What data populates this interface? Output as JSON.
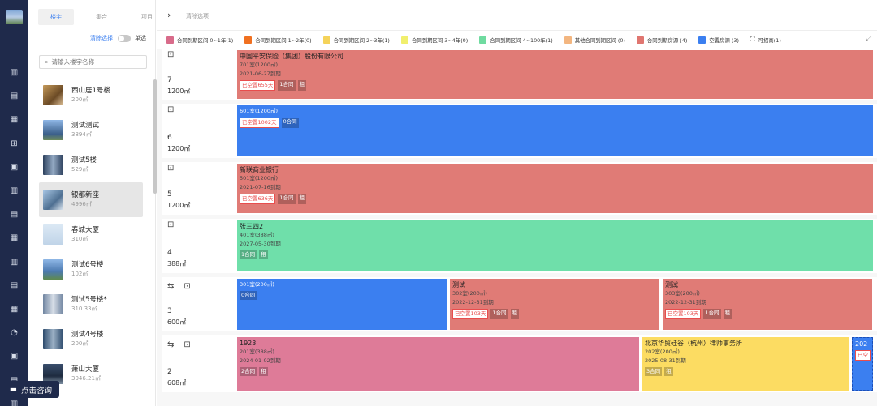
{
  "rail": {
    "icons": [
      "book-icon",
      "document-icon",
      "ledger-icon",
      "car-icon",
      "gear-icon",
      "list-icon",
      "ticket-icon",
      "wallet-icon",
      "grid-icon",
      "chart-icon",
      "calendar-icon",
      "refresh-icon",
      "money-icon",
      "report-icon",
      "folder-icon"
    ]
  },
  "consult": {
    "label": "点击咨询"
  },
  "panel": {
    "tabs": [
      "楼宇",
      "集合",
      "项目"
    ],
    "clear": "清除选择",
    "single": "单选",
    "search_placeholder": "请输入楼宇名称",
    "buildings": [
      {
        "name": "西山居1号楼",
        "area": "200㎡"
      },
      {
        "name": "测试测试",
        "area": "3894㎡"
      },
      {
        "name": "测试5楼",
        "area": "529㎡"
      },
      {
        "name": "银都新座",
        "area": "4996㎡"
      },
      {
        "name": "春城大厦",
        "area": "310㎡"
      },
      {
        "name": "测试6号楼",
        "area": "102㎡"
      },
      {
        "name": "测试5号楼*",
        "area": "310.33㎡"
      },
      {
        "name": "测试4号楼",
        "area": "200㎡"
      },
      {
        "name": "萧山大厦",
        "area": "3046.21㎡"
      }
    ]
  },
  "topbar": {
    "filter_title": "清除选项"
  },
  "legend": [
    {
      "label": "合同到期区间 0~1年(1)",
      "color": "#d86b8a"
    },
    {
      "label": "合同到期区间 1~2年(0)",
      "color": "#f07020"
    },
    {
      "label": "合同到期区间 2~3年(1)",
      "color": "#f5d35a"
    },
    {
      "label": "合同到期区间 3~4年(0)",
      "color": "#f1ef6d"
    },
    {
      "label": "合同到期区间 4~100年(1)",
      "color": "#6fdba0"
    },
    {
      "label": "其他合同到期区间 (0)",
      "color": "#f3b680"
    },
    {
      "label": "合同到期房源 (4)",
      "color": "#e07670"
    },
    {
      "label": "空置房源 (3)",
      "color": "#3b7ff0"
    },
    {
      "label": "可招商(1)",
      "color": ""
    }
  ],
  "colors": {
    "red": "#e07b76",
    "blue": "#3b7ff0",
    "green": "#6fdfaa",
    "pink": "#de7b98",
    "yellow": "#fcdc62"
  },
  "floors": [
    {
      "num": "7",
      "area": "1200㎡",
      "units": [
        {
          "name": "中国平安保险（集团）股份有限公司",
          "room": "701室(1200㎡)",
          "date": "2021-06-27到期",
          "vac": "已空置655天",
          "contracts": "1合同",
          "rent": "租",
          "color": "red"
        }
      ]
    },
    {
      "num": "6",
      "area": "1200㎡",
      "units": [
        {
          "name": "",
          "room": "601室(1200㎡)",
          "date": "",
          "vac": "已空置1002天",
          "contracts": "0合同",
          "rent": "",
          "color": "blue"
        }
      ]
    },
    {
      "num": "5",
      "area": "1200㎡",
      "units": [
        {
          "name": "新联商业银行",
          "room": "501室(1200㎡)",
          "date": "2021-07-16到期",
          "vac": "已空置636天",
          "contracts": "1合同",
          "rent": "租",
          "color": "red"
        }
      ]
    },
    {
      "num": "4",
      "area": "388㎡",
      "units": [
        {
          "name": "张三四2",
          "room": "401室(388㎡)",
          "date": "2027-05-30到期",
          "vac": "",
          "contracts": "1合同",
          "rent": "租",
          "color": "green"
        }
      ]
    },
    {
      "num": "3",
      "area": "600㎡",
      "units": [
        {
          "name": "",
          "room": "301室(200㎡)",
          "date": "",
          "vac": "",
          "contracts": "0合同",
          "rent": "",
          "color": "blue"
        },
        {
          "name": "测试",
          "room": "302室(200㎡)",
          "date": "2022-12-31到期",
          "vac": "已空置103天",
          "contracts": "1合同",
          "rent": "租",
          "color": "red"
        },
        {
          "name": "测试",
          "room": "303室(200㎡)",
          "date": "2022-12-31到期",
          "vac": "已空置103天",
          "contracts": "1合同",
          "rent": "租",
          "color": "red"
        }
      ]
    },
    {
      "num": "2",
      "area": "608㎡",
      "units": [
        {
          "name": "1923",
          "room": "201室(388㎡)",
          "date": "2024-01-02到期",
          "vac": "",
          "contracts": "2合同",
          "rent": "租",
          "color": "pink"
        },
        {
          "name": "北京华贸硅谷（杭州）律师事务所",
          "room": "202室(200㎡)",
          "date": "2025-08-31到期",
          "vac": "",
          "contracts": "3合同",
          "rent": "租",
          "color": "yellow"
        },
        {
          "name": "202",
          "room": "",
          "date": "",
          "vac": "已空",
          "contracts": "0合",
          "rent": "",
          "color": "blue"
        }
      ]
    }
  ]
}
